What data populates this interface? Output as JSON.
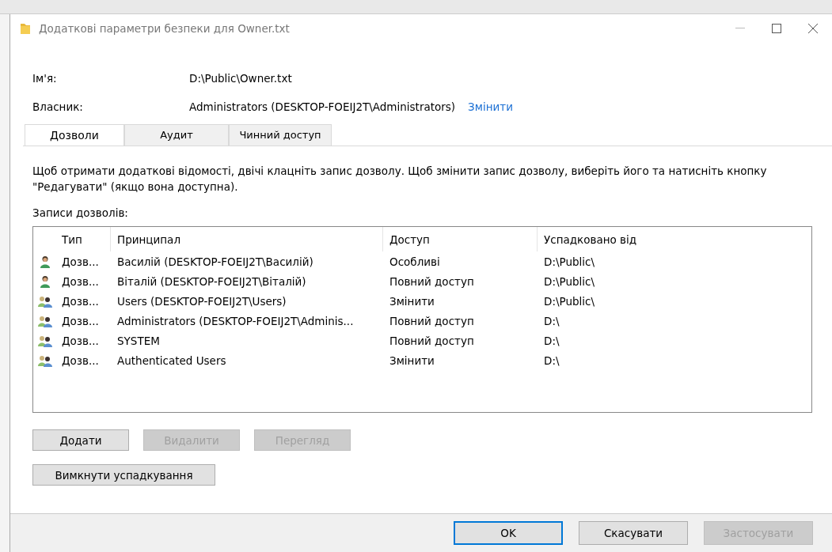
{
  "window": {
    "title": "Додаткові параметри безпеки для Owner.txt"
  },
  "name_field": {
    "label": "Ім'я:",
    "value": "D:\\Public\\Owner.txt"
  },
  "owner_field": {
    "label": "Власник:",
    "value": "Administrators (DESKTOP-FOEIJ2T\\Administrators)",
    "link": "Змінити"
  },
  "tabs": [
    {
      "label": "Дозволи",
      "selected": true
    },
    {
      "label": "Аудит",
      "selected": false
    },
    {
      "label": "Чинний доступ",
      "selected": false
    }
  ],
  "info_text": "Щоб отримати додаткові відомості, двічі клацніть запис дозволу. Щоб змінити запис дозволу, виберіть його та натисніть кнопку \"Редагувати\" (якщо вона доступна).",
  "list_label": "Записи дозволів:",
  "table": {
    "columns": [
      "Тип",
      "Принципал",
      "Доступ",
      "Успадковано від"
    ],
    "rows": [
      {
        "kind": "user",
        "type": "Дозв...",
        "principal": "Василій (DESKTOP-FOEIJ2T\\Василій)",
        "access": "Особливі",
        "inherited": "D:\\Public\\"
      },
      {
        "kind": "user",
        "type": "Дозв...",
        "principal": "Віталій (DESKTOP-FOEIJ2T\\Віталій)",
        "access": "Повний доступ",
        "inherited": "D:\\Public\\"
      },
      {
        "kind": "group",
        "type": "Дозв...",
        "principal": "Users (DESKTOP-FOEIJ2T\\Users)",
        "access": "Змінити",
        "inherited": "D:\\Public\\"
      },
      {
        "kind": "group",
        "type": "Дозв...",
        "principal": "Administrators (DESKTOP-FOEIJ2T\\Adminis...",
        "access": "Повний доступ",
        "inherited": "D:\\"
      },
      {
        "kind": "group",
        "type": "Дозв...",
        "principal": "SYSTEM",
        "access": "Повний доступ",
        "inherited": "D:\\"
      },
      {
        "kind": "group",
        "type": "Дозв...",
        "principal": "Authenticated Users",
        "access": "Змінити",
        "inherited": "D:\\"
      }
    ]
  },
  "list_buttons": [
    {
      "label": "Додати",
      "disabled": false
    },
    {
      "label": "Видалити",
      "disabled": true
    },
    {
      "label": "Перегляд",
      "disabled": true
    }
  ],
  "inheritance_button": {
    "label": "Вимкнути успадкування"
  },
  "dialog_buttons": [
    {
      "label": "OK",
      "disabled": false,
      "default": true
    },
    {
      "label": "Скасувати",
      "disabled": false,
      "default": false
    },
    {
      "label": "Застосувати",
      "disabled": true,
      "default": false
    }
  ]
}
